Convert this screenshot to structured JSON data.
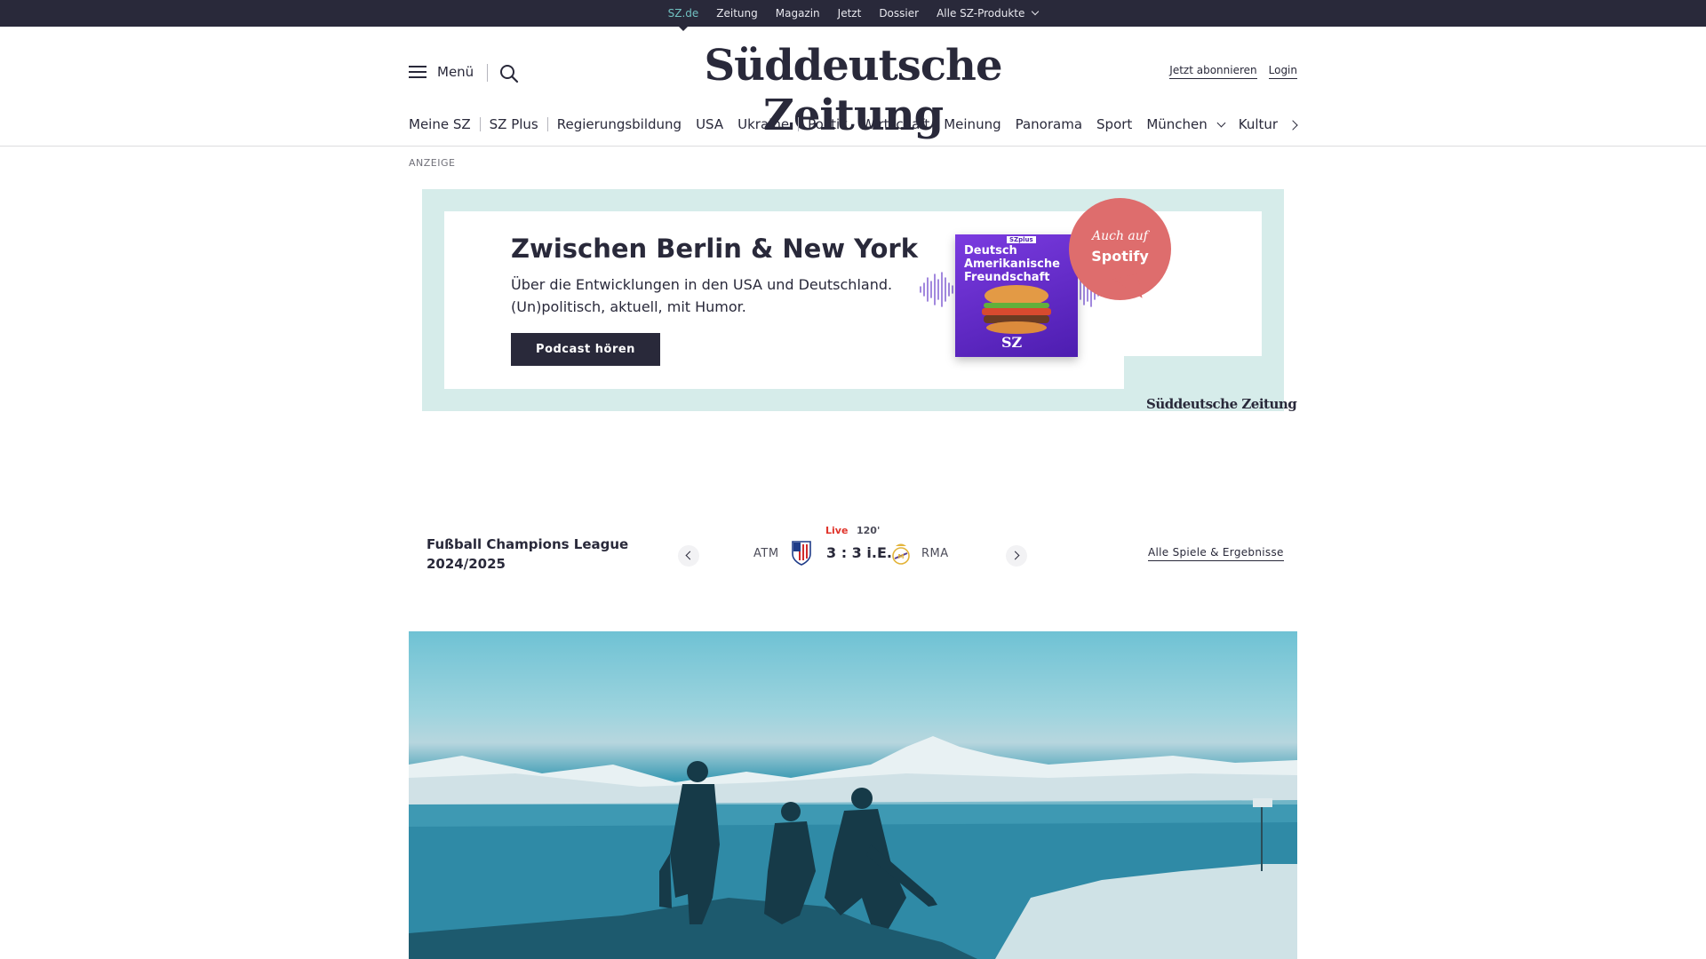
{
  "topbar": {
    "items": [
      {
        "label": "SZ.de",
        "active": true
      },
      {
        "label": "Zeitung"
      },
      {
        "label": "Magazin"
      },
      {
        "label": "Jetzt"
      },
      {
        "label": "Dossier"
      },
      {
        "label": "Alle SZ-Produkte",
        "dropdown": true
      }
    ]
  },
  "header": {
    "menu_label": "Menü",
    "logo": "Süddeutsche Zeitung",
    "subscribe_label": "Jetzt abonnieren",
    "login_label": "Login"
  },
  "nav": {
    "items": [
      "Meine SZ",
      "SZ Plus",
      "Regierungsbildung",
      "USA",
      "Ukraine",
      "Politik",
      "Wirtschaft",
      "Meinung",
      "Panorama",
      "Sport",
      "München",
      "Kultur"
    ]
  },
  "ad": {
    "label": "ANZEIGE",
    "title": "Zwischen Berlin & New York",
    "text": "Über die Entwicklungen in den USA und Deutschland. (Un)politisch, aktuell, mit Humor.",
    "button_label": "Podcast hören",
    "cover_badge": "SZplus",
    "cover_title": "Deutsch Amerikanische Freundschaft",
    "cover_logo": "SZ",
    "bubble_line1": "Auch auf",
    "bubble_line2": "Spotify",
    "brand": "Süddeutsche Zeitung",
    "accent": "#d6ecea",
    "bubble_color": "#de6d6d"
  },
  "scores": {
    "league": "Fußball Champions League 2024/2025",
    "status": "Live",
    "minute": "120'",
    "home_team": "ATM",
    "away_team": "RMA",
    "result": "3 : 3 i.E.",
    "all_games_label": "Alle Spiele & Ergebnisse"
  },
  "colors": {
    "dark": "#29293a",
    "topbar_active": "#71c1c1",
    "live": "#e0332a"
  }
}
